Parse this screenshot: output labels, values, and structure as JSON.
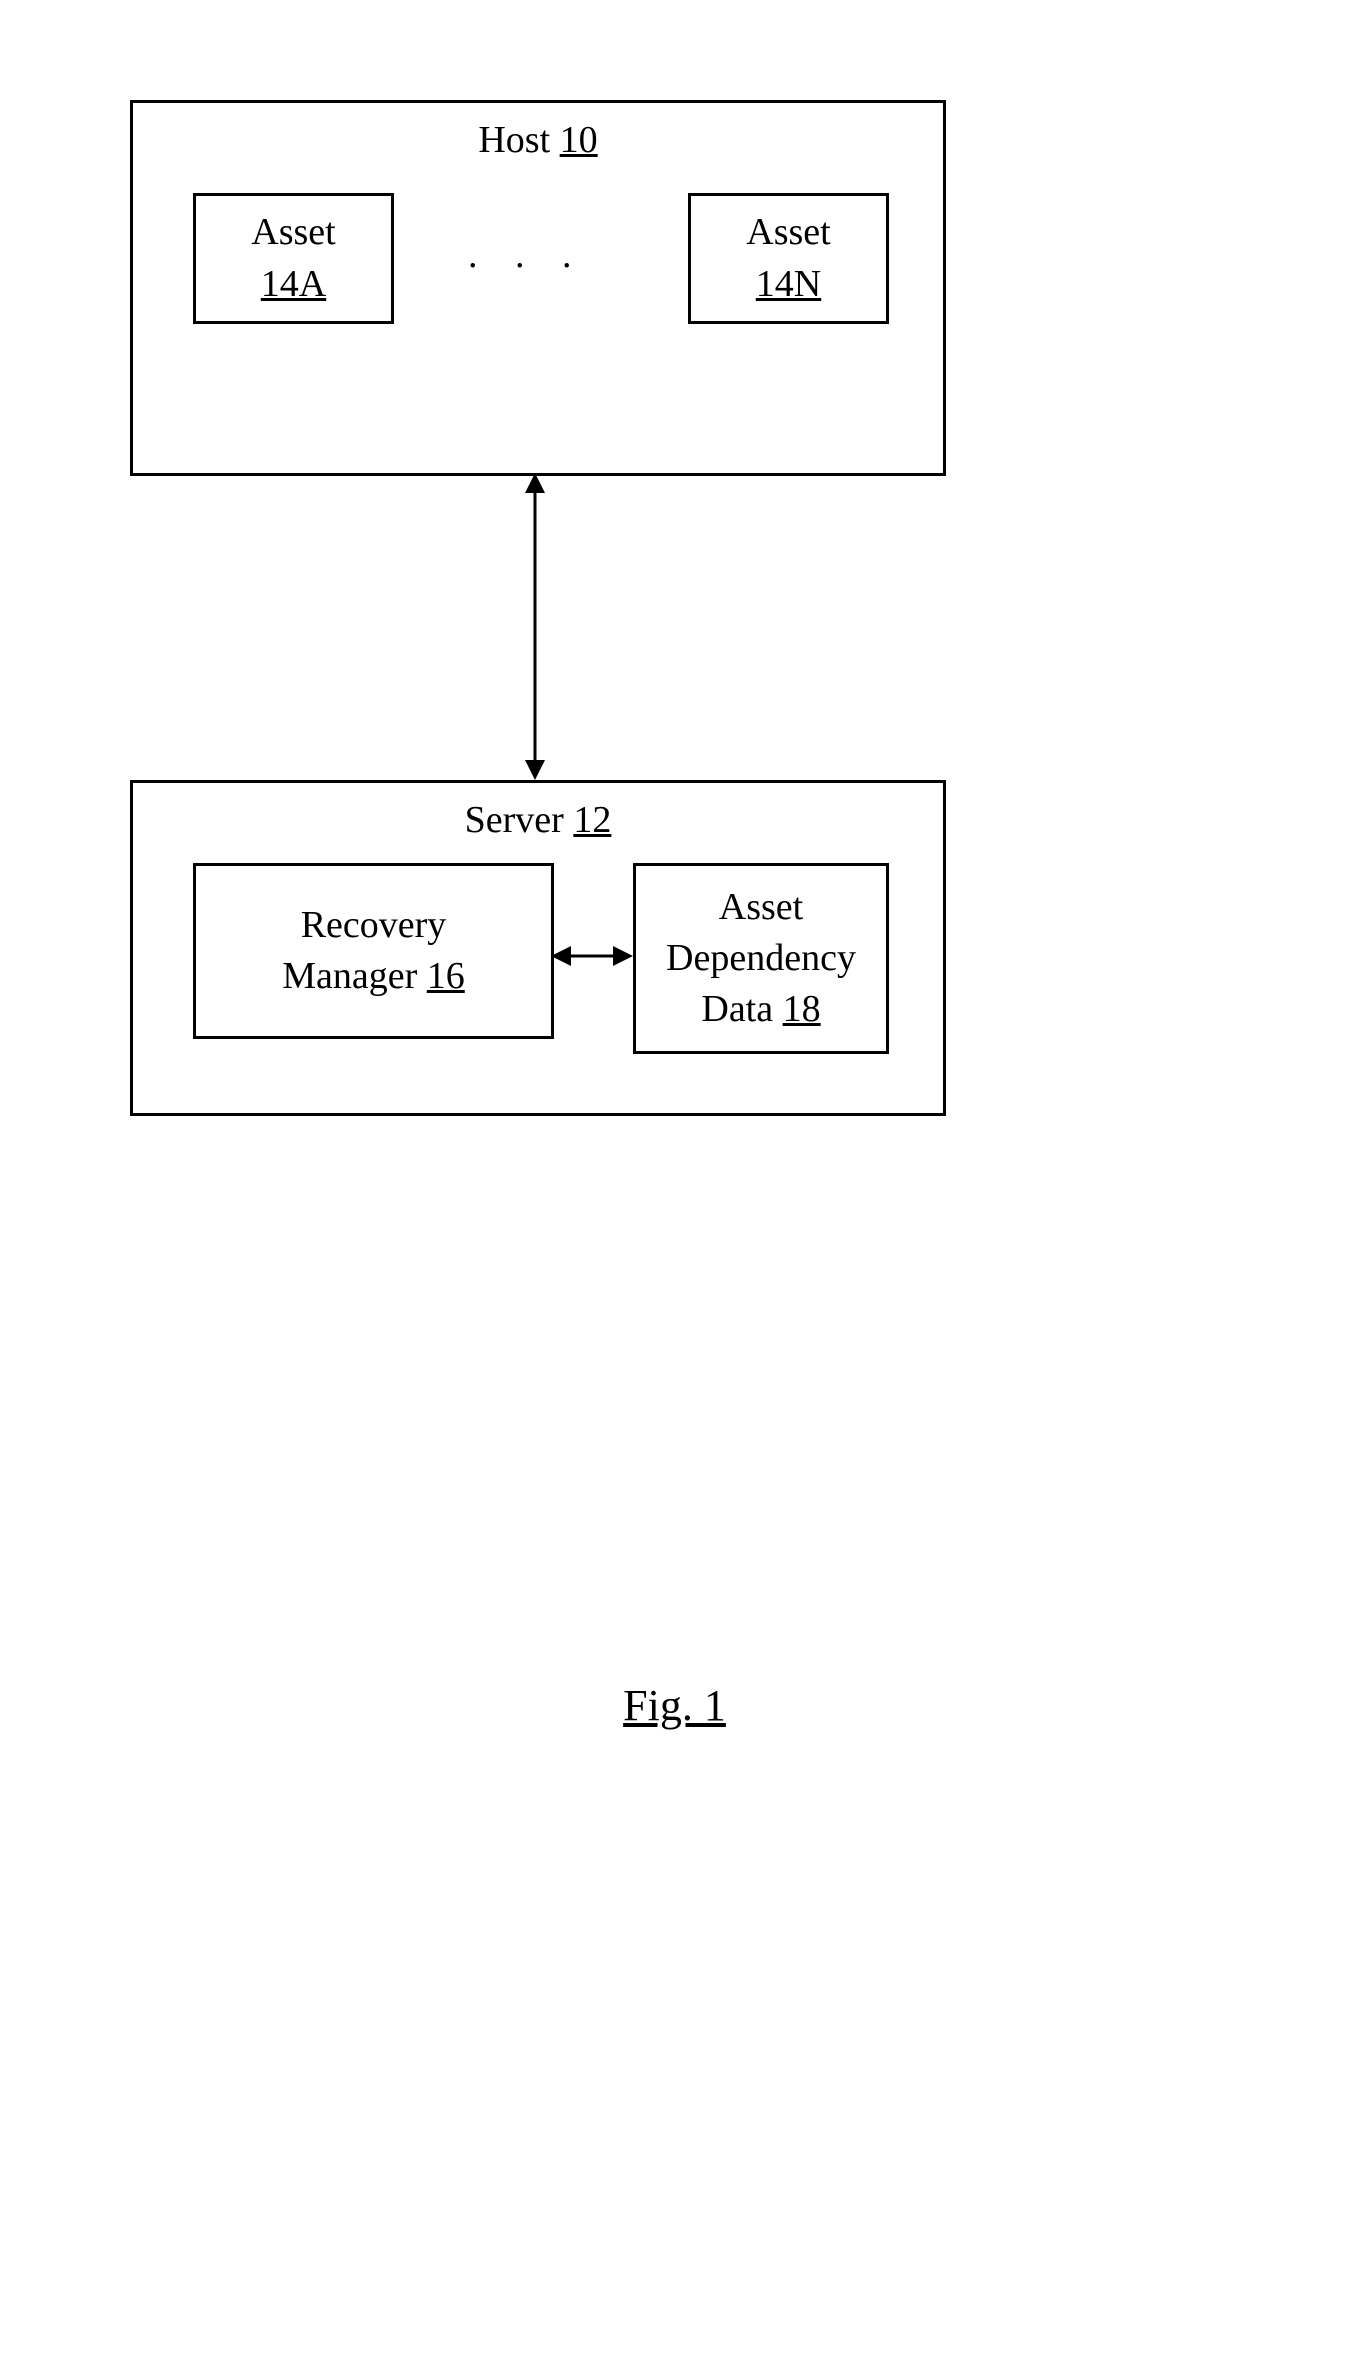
{
  "host": {
    "title_prefix": "Host ",
    "title_ref": "10",
    "asset_a": {
      "label": "Asset",
      "ref": "14A"
    },
    "asset_n": {
      "label": "Asset",
      "ref": "14N"
    },
    "ellipsis": ". . ."
  },
  "server": {
    "title_prefix": "Server ",
    "title_ref": "12",
    "recovery": {
      "line1": "Recovery",
      "line2_prefix": "Manager ",
      "line2_ref": "16"
    },
    "asset_dep": {
      "line1": "Asset",
      "line2": "Dependency",
      "line3_prefix": "Data ",
      "line3_ref": "18"
    }
  },
  "caption": "Fig. 1"
}
